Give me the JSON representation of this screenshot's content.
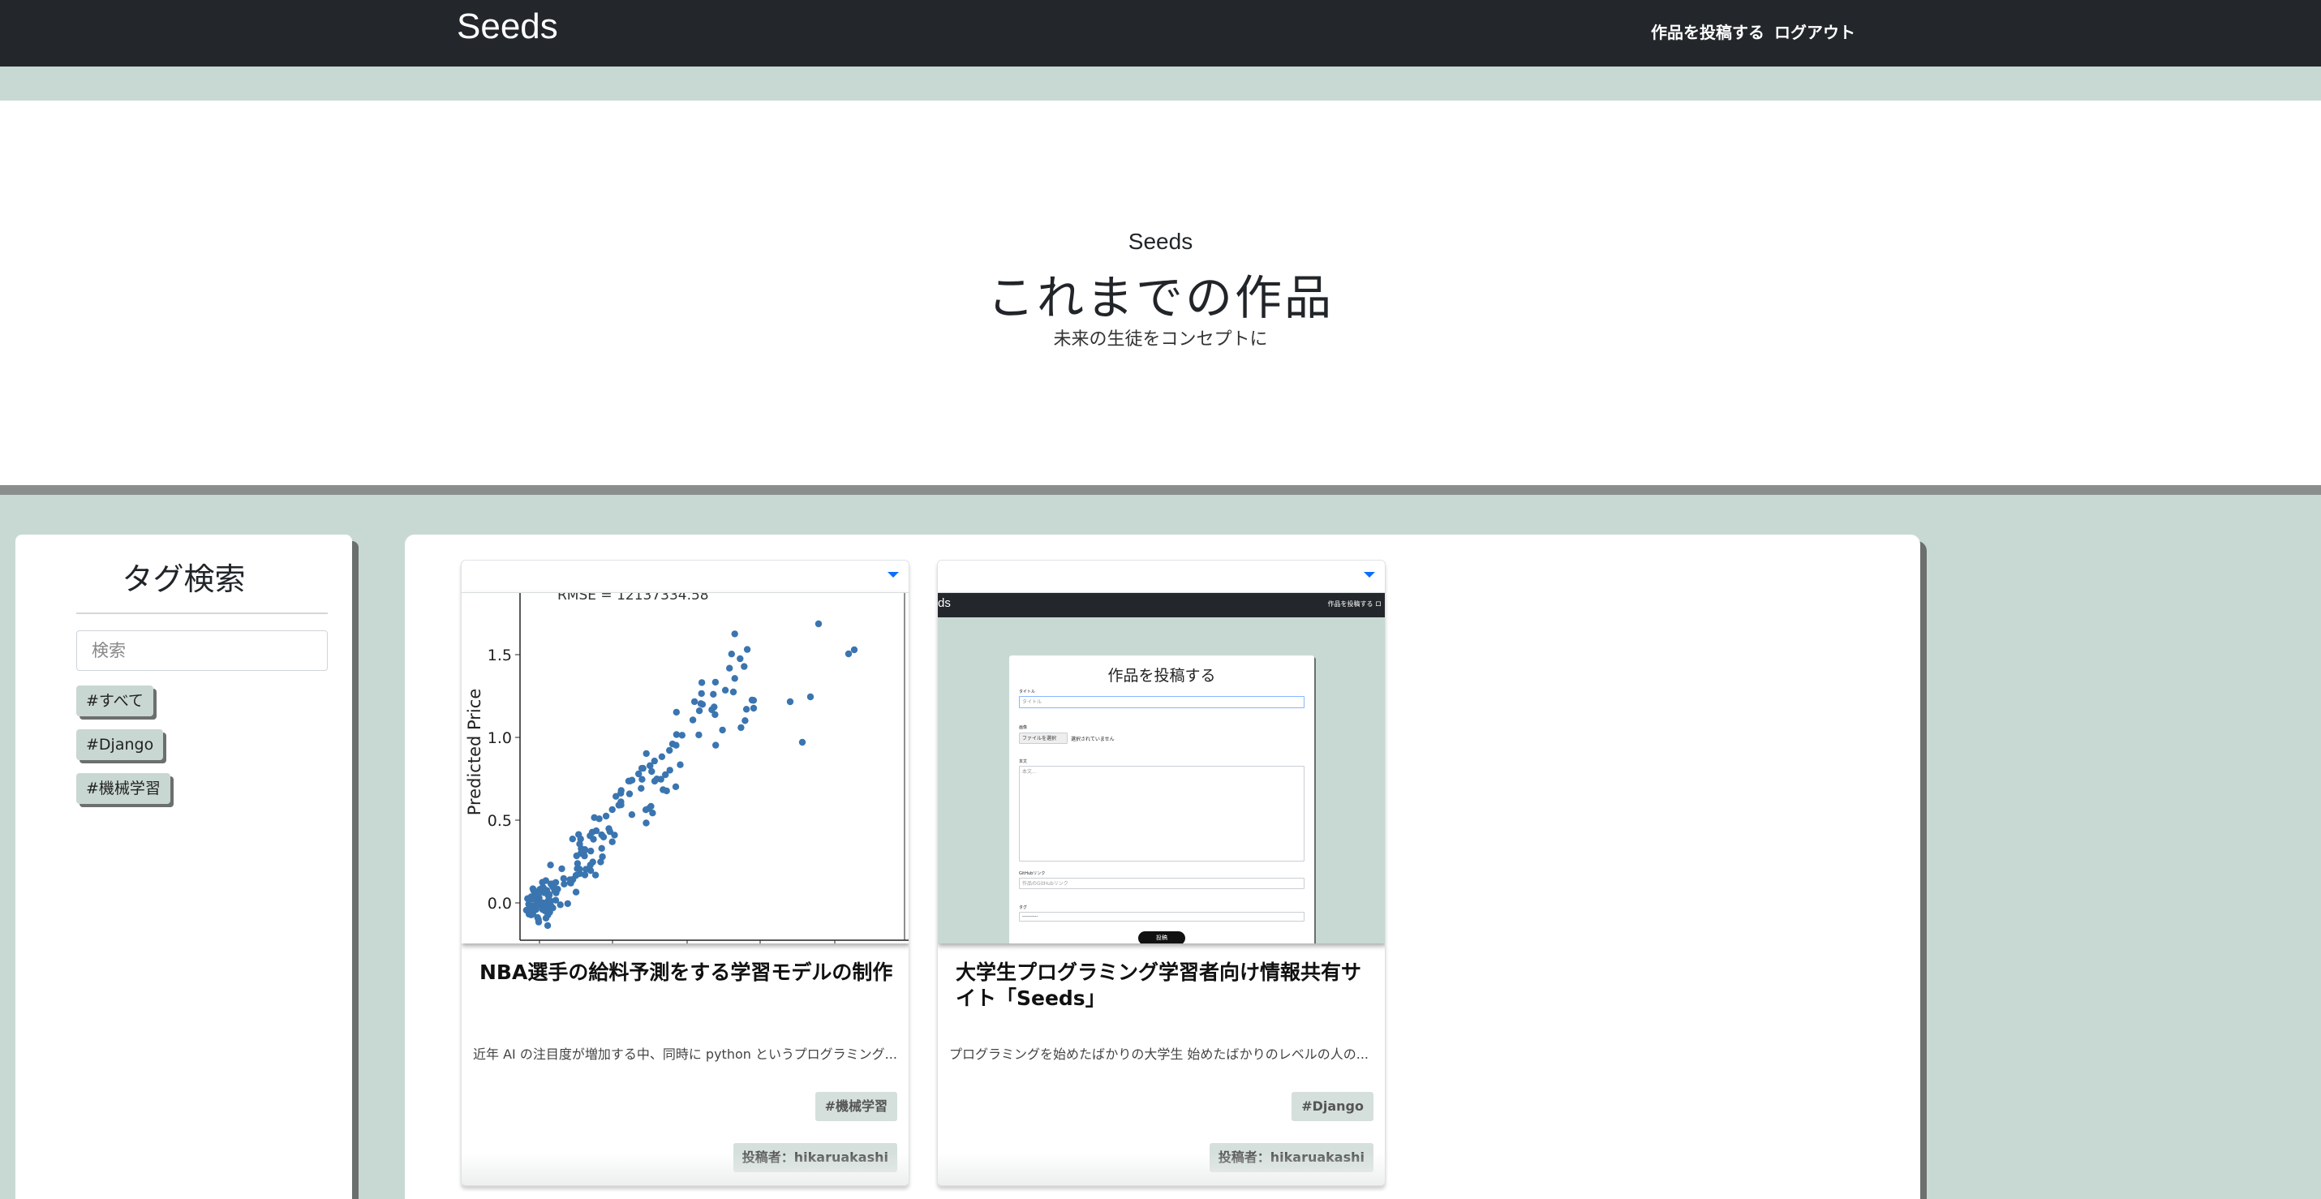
{
  "navbar": {
    "brand": "Seeds",
    "links": {
      "post": "作品を投稿する",
      "logout": "ログアウト"
    }
  },
  "hero": {
    "small": "Seeds",
    "title": "これまでの作品",
    "subtitle": "未来の生徒をコンセプトに"
  },
  "sidebar": {
    "title": "タグ検索",
    "search_placeholder": "検索",
    "tags": [
      "#すべて",
      "#Django",
      "#機械学習"
    ]
  },
  "cards": [
    {
      "title": "NBA選手の給料予測をする学習モデルの制作",
      "description": "近年 AI の注目度が増加する中、同時に python というプログラミング...",
      "tag": "#機械学習",
      "author": "投稿者：hikaruakashi",
      "image": {
        "kind": "scatter-plot",
        "caption": "RMSE = 12137334.58",
        "ylabel": "Predicted Price",
        "yticks": [
          "1.5",
          "1.0",
          "0.5",
          "0.0"
        ],
        "point_color": "#3a75b0"
      }
    },
    {
      "title": "大学生プログラミング学習者向け情報共有サイト「Seeds」",
      "description": "プログラミングを始めたばかりの大学生 始めたばかりのレベルの人の...",
      "tag": "#Django",
      "author": "投稿者：hikaruakashi",
      "image": {
        "kind": "screenshot",
        "brand": "ds",
        "nav": "作品を投稿する  ロ",
        "form_title": "作品を投稿する",
        "label_title": "タイトル",
        "title_placeholder": "タイトル",
        "label_image": "画像",
        "file_button": "ファイルを選択",
        "file_status": "選択されていません",
        "label_body": "本文",
        "body_placeholder": "本文...",
        "label_github": "GitHubリンク",
        "github_placeholder": "作品のGitHubリンク",
        "label_tag": "タグ",
        "tag_value": "---------",
        "send_button": "投稿"
      }
    }
  ],
  "colors": {
    "navbar": "#23272b",
    "background": "#c8d9d3",
    "tag_bg": "#d5e0dc",
    "accent": "#0d6efd"
  }
}
